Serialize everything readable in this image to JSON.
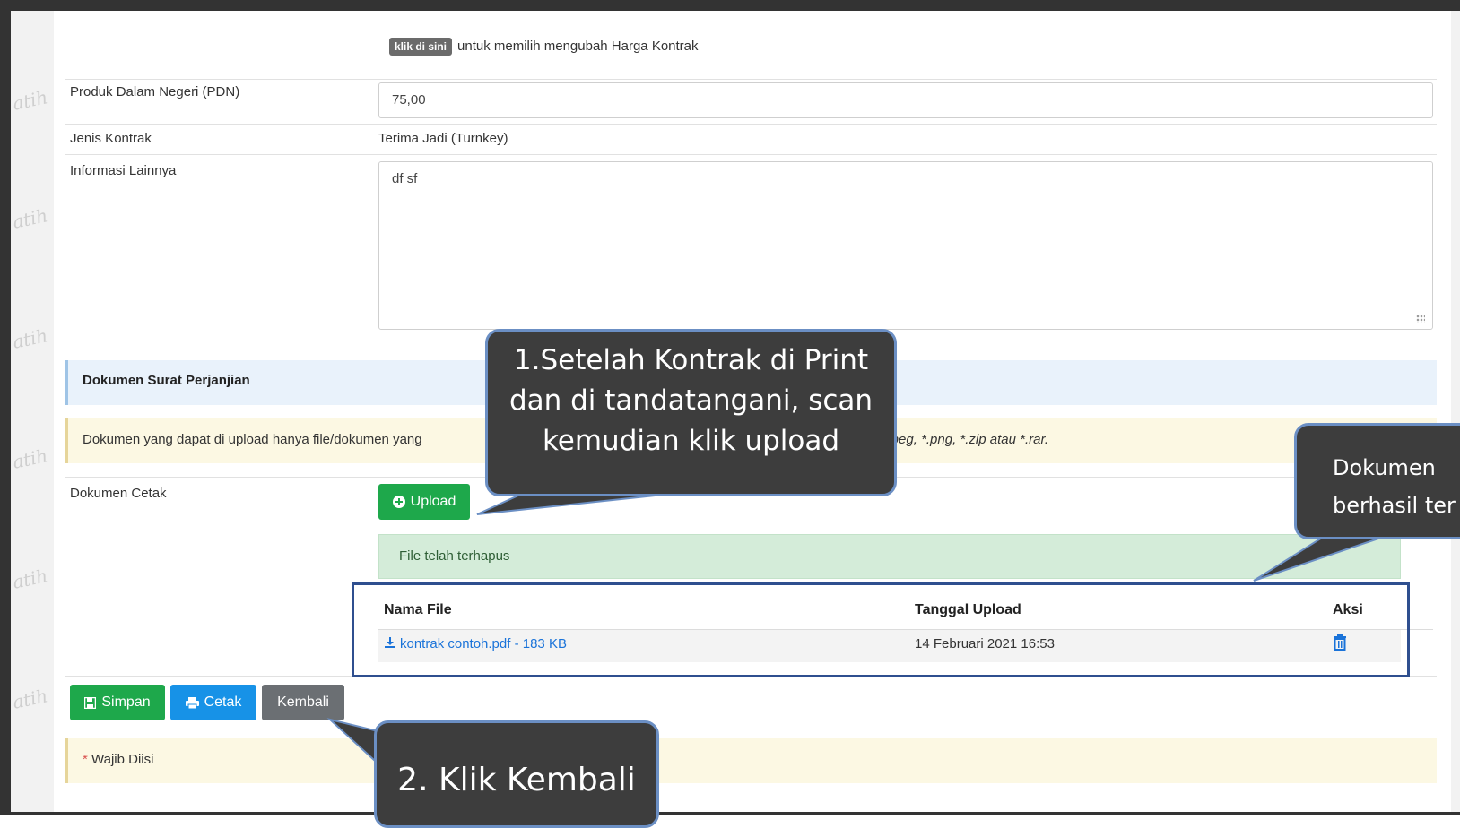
{
  "form": {
    "price_link_badge": "klik di sini",
    "price_link_text": "untuk memilih mengubah Harga Kontrak",
    "pdn_label": "Produk Dalam Negeri (PDN)",
    "pdn_value": "75,00",
    "jenis_label": "Jenis Kontrak",
    "jenis_value": "Terima Jadi (Turnkey)",
    "info_label": "Informasi Lainnya",
    "info_value": "df sf"
  },
  "section": {
    "title": "Dokumen Surat Perjanjian",
    "notice_start": "Dokumen yang dapat di upload hanya file/dokumen yang",
    "notice_end": ", *.jpeg, *.png, *.zip atau *.rar."
  },
  "dokumen_cetak": {
    "label": "Dokumen Cetak",
    "upload_label": "Upload",
    "success_message": "File telah terhapus",
    "table": {
      "headers": [
        "Nama File",
        "Tanggal Upload",
        "Aksi"
      ],
      "rows": [
        {
          "file": "kontrak contoh.pdf  - 183 KB",
          "date": "14 Februari 2021 16:53",
          "action_icon": "trash-icon"
        }
      ]
    }
  },
  "actions": {
    "simpan": "Simpan",
    "cetak": "Cetak",
    "kembali": "Kembali"
  },
  "required_note": {
    "asterisk": "*",
    "text": "Wajib Diisi"
  },
  "callouts": {
    "one": [
      "1.Setelah Kontrak di Print",
      "dan di tandatangani, scan",
      "kemudian klik upload"
    ],
    "two": "2. Klik Kembali",
    "three": [
      "Dokumen",
      "berhasil ter"
    ]
  },
  "watermark": "atih",
  "colors": {
    "success_green": "#1ea84b",
    "primary_blue": "#1792e7",
    "callout_bg": "#3d3d3d",
    "table_outline": "#2f4f8f"
  }
}
